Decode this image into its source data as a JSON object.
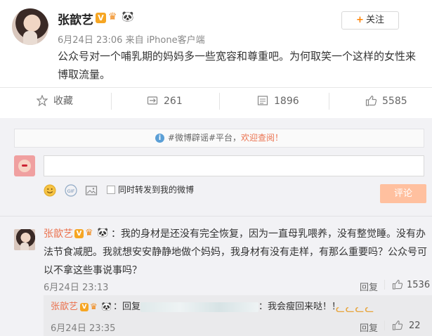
{
  "post": {
    "author": "张歆艺",
    "follow_label": "关注",
    "time": "6月24日 23:06",
    "source": "来自 iPhone客户端",
    "text": "公众号对一个哺乳期的妈妈多一些宽容和尊重吧。为何取笑一个这样的女性来博取流量。"
  },
  "actions": {
    "favorite": "收藏",
    "repost": "261",
    "comment": "1896",
    "like": "5585"
  },
  "notice": {
    "prefix": "#微博辟谣#平台，",
    "link": "欢迎查阅！"
  },
  "compose": {
    "placeholder": "",
    "repost_label": "同时转发到我的微博",
    "submit_label": "评论"
  },
  "comments": [
    {
      "author": "张歆艺",
      "text": "：我的身材是还没有完全恢复，因为一直母乳喂养，没有整觉睡。没有办法节食减肥。我就想安安静静地做个妈妈，我身材有没有走样，有那么重要吗？公众号可以不拿这些事说事吗？",
      "time": "6月24日 23:13",
      "reply_label": "回复",
      "likes": "1536"
    }
  ],
  "sub_comment": {
    "author": "张歆艺",
    "prefix": "：回复",
    "suffix": "：我会瘦回来哒！！",
    "time": "6月24日 23:35",
    "reply_label": "回复",
    "likes": "22"
  },
  "icons": [
    "vip-v-icon",
    "crown-icon",
    "panda-icon",
    "star-icon",
    "repost-icon",
    "comment-icon",
    "like-icon",
    "info-icon",
    "smiley-icon",
    "gif-icon",
    "image-icon"
  ],
  "colors": {
    "accent": "#ff8200",
    "name_link": "#eb7350",
    "submit_disabled": "#ffc09f",
    "info_blue": "#5b9fd6"
  }
}
